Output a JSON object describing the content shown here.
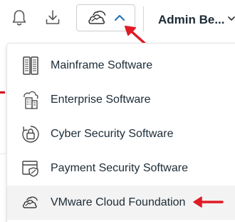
{
  "header": {
    "notification_icon": "bell-icon",
    "download_icon": "download-icon",
    "product_switcher_icon": "vmware-cloud-icon",
    "product_switcher_state": "expanded",
    "user_name": "Admin Be..."
  },
  "menu": {
    "items": [
      {
        "label": "Mainframe Software",
        "icon": "mainframe-icon"
      },
      {
        "label": "Enterprise Software",
        "icon": "enterprise-building-icon"
      },
      {
        "label": "Cyber Security Software",
        "icon": "security-lock-icon"
      },
      {
        "label": "Payment Security Software",
        "icon": "payment-shield-icon"
      },
      {
        "label": "VMware Cloud Foundation",
        "icon": "vmware-cloud-icon",
        "highlighted": true
      }
    ]
  },
  "colors": {
    "accent": "#1f6fb2",
    "annotation_arrow": "#e01b24",
    "text": "#1c2b36",
    "icon": "#555555",
    "highlight_bg": "#f3f3f3"
  }
}
